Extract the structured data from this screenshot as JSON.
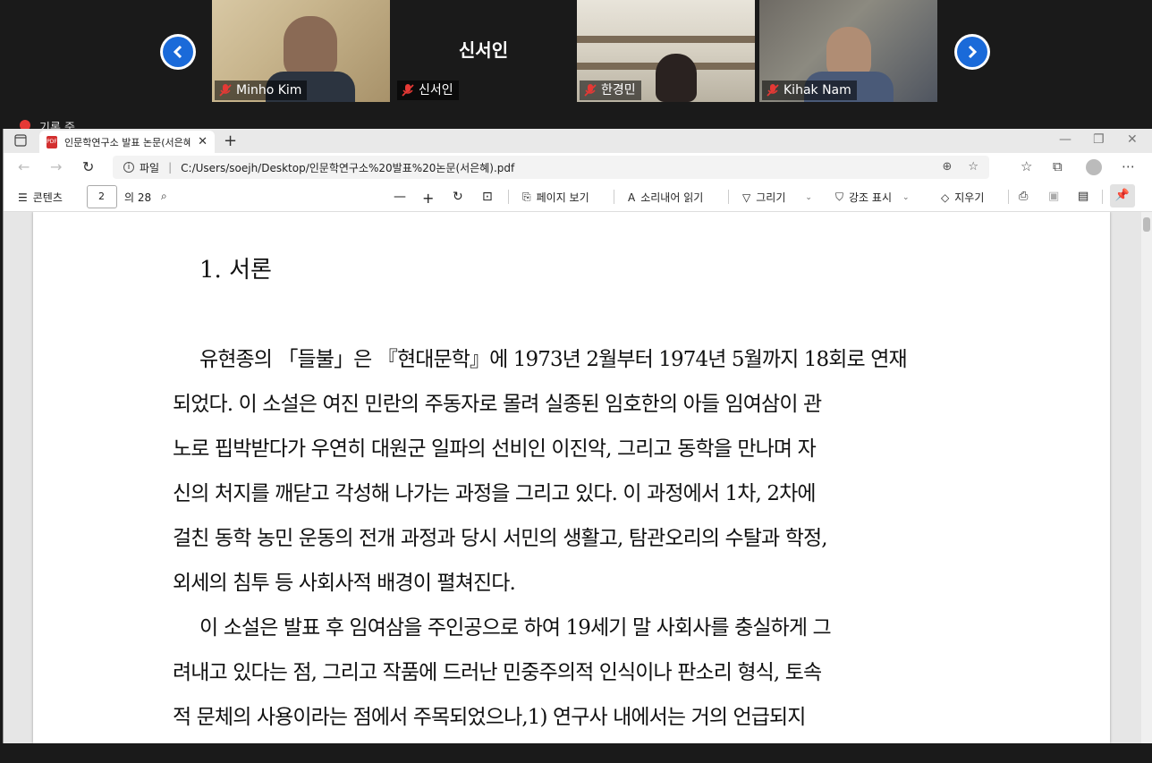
{
  "video": {
    "participants": [
      {
        "name": "Minho Kim",
        "muted": true
      },
      {
        "name": "신서인",
        "muted": true,
        "big_name": "신서인"
      },
      {
        "name": "한경민",
        "muted": true
      },
      {
        "name": "Kihak Nam",
        "muted": true
      }
    ],
    "recording_label": "기록 중"
  },
  "browser": {
    "tab_title": "인문학연구소 발표 논문(서은혜)",
    "address_prefix": "파일",
    "address": "C:/Users/soejh/Desktop/인문학연구소%20발표%20논문(서은혜).pdf"
  },
  "pdf_toolbar": {
    "contents_label": "콘텐츠",
    "page_current": "2",
    "page_total": "의 28",
    "page_view_label": "페이지 보기",
    "read_aloud_label": "소리내어 읽기",
    "draw_label": "그리기",
    "highlight_label": "강조 표시",
    "erase_label": "지우기"
  },
  "document": {
    "heading": "1.  서론",
    "lines": [
      "유현종의 「들불」은 『현대문학』에 1973년 2월부터 1974년 5월까지 18회로 연재",
      "되었다. 이 소설은 여진 민란의 주동자로 몰려 실종된 임호한의 아들 임여삼이 관",
      "노로 핍박받다가 우연히 대원군 일파의 선비인 이진악, 그리고 동학을 만나며 자",
      "신의 처지를 깨닫고 각성해 나가는 과정을 그리고 있다. 이 과정에서 1차, 2차에",
      "걸친 동학 농민 운동의 전개 과정과 당시 서민의 생활고, 탐관오리의 수탈과 학정,",
      "외세의 침투 등 사회사적 배경이 펼쳐진다.",
      "이 소설은 발표 후 임여삼을 주인공으로 하여 19세기 말 사회사를 충실하게 그",
      "려내고 있다는 점, 그리고 작품에 드러난 민중주의적 인식이나 판소리 형식, 토속",
      "적 문체의 사용이라는 점에서 주목되었으나,1) 연구사 내에서는 거의 언급되지"
    ]
  }
}
